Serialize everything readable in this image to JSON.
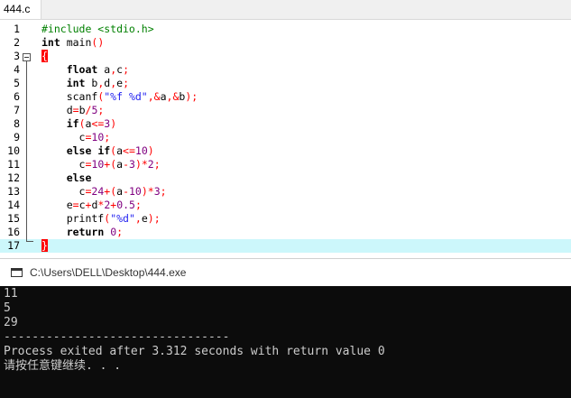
{
  "tab": {
    "label": "444.c"
  },
  "editor": {
    "line_numbers": [
      "1",
      "2",
      "3",
      "4",
      "5",
      "6",
      "7",
      "8",
      "9",
      "10",
      "11",
      "12",
      "13",
      "14",
      "15",
      "16",
      "17"
    ],
    "lines": [
      [
        {
          "t": "#include <stdio.h>",
          "c": "p"
        }
      ],
      [
        {
          "t": "int",
          "c": "k"
        },
        {
          "t": " main",
          "c": "x"
        },
        {
          "t": "()",
          "c": "o"
        }
      ],
      [
        {
          "t": "{",
          "c": "brace"
        }
      ],
      [],
      [
        {
          "t": "    ",
          "c": "x"
        },
        {
          "t": "float",
          "c": "k"
        },
        {
          "t": " a",
          "c": "x"
        },
        {
          "t": ",",
          "c": "o"
        },
        {
          "t": "c",
          "c": "x"
        },
        {
          "t": ";",
          "c": "o"
        }
      ],
      [
        {
          "t": "    ",
          "c": "x"
        },
        {
          "t": "int",
          "c": "k"
        },
        {
          "t": " b",
          "c": "x"
        },
        {
          "t": ",",
          "c": "o"
        },
        {
          "t": "d",
          "c": "x"
        },
        {
          "t": ",",
          "c": "o"
        },
        {
          "t": "e",
          "c": "x"
        },
        {
          "t": ";",
          "c": "o"
        }
      ],
      [
        {
          "t": "    scanf",
          "c": "x"
        },
        {
          "t": "(",
          "c": "o"
        },
        {
          "t": "\"%f %d\"",
          "c": "s"
        },
        {
          "t": ",&",
          "c": "o"
        },
        {
          "t": "a",
          "c": "x"
        },
        {
          "t": ",&",
          "c": "o"
        },
        {
          "t": "b",
          "c": "x"
        },
        {
          "t": ");",
          "c": "o"
        }
      ],
      [
        {
          "t": "    d",
          "c": "x"
        },
        {
          "t": "=",
          "c": "o"
        },
        {
          "t": "b",
          "c": "x"
        },
        {
          "t": "/",
          "c": "o"
        },
        {
          "t": "5",
          "c": "n"
        },
        {
          "t": ";",
          "c": "o"
        }
      ],
      [
        {
          "t": "    ",
          "c": "x"
        },
        {
          "t": "if",
          "c": "k"
        },
        {
          "t": "(",
          "c": "o"
        },
        {
          "t": "a",
          "c": "x"
        },
        {
          "t": "<=",
          "c": "o"
        },
        {
          "t": "3",
          "c": "n"
        },
        {
          "t": ")",
          "c": "o"
        }
      ],
      [
        {
          "t": "      c",
          "c": "x"
        },
        {
          "t": "=",
          "c": "o"
        },
        {
          "t": "10",
          "c": "n"
        },
        {
          "t": ";",
          "c": "o"
        }
      ],
      [
        {
          "t": "    ",
          "c": "x"
        },
        {
          "t": "else if",
          "c": "k"
        },
        {
          "t": "(",
          "c": "o"
        },
        {
          "t": "a",
          "c": "x"
        },
        {
          "t": "<=",
          "c": "o"
        },
        {
          "t": "10",
          "c": "n"
        },
        {
          "t": ")",
          "c": "o"
        }
      ],
      [
        {
          "t": "      c",
          "c": "x"
        },
        {
          "t": "=",
          "c": "o"
        },
        {
          "t": "10",
          "c": "n"
        },
        {
          "t": "+(",
          "c": "o"
        },
        {
          "t": "a",
          "c": "x"
        },
        {
          "t": "-",
          "c": "o"
        },
        {
          "t": "3",
          "c": "n"
        },
        {
          "t": ")*",
          "c": "o"
        },
        {
          "t": "2",
          "c": "n"
        },
        {
          "t": ";",
          "c": "o"
        }
      ],
      [
        {
          "t": "    ",
          "c": "x"
        },
        {
          "t": "else",
          "c": "k"
        }
      ],
      [
        {
          "t": "      c",
          "c": "x"
        },
        {
          "t": "=",
          "c": "o"
        },
        {
          "t": "24",
          "c": "n"
        },
        {
          "t": "+(",
          "c": "o"
        },
        {
          "t": "a",
          "c": "x"
        },
        {
          "t": "-",
          "c": "o"
        },
        {
          "t": "10",
          "c": "n"
        },
        {
          "t": ")*",
          "c": "o"
        },
        {
          "t": "3",
          "c": "n"
        },
        {
          "t": ";",
          "c": "o"
        }
      ],
      [
        {
          "t": "    e",
          "c": "x"
        },
        {
          "t": "=",
          "c": "o"
        },
        {
          "t": "c",
          "c": "x"
        },
        {
          "t": "+",
          "c": "o"
        },
        {
          "t": "d",
          "c": "x"
        },
        {
          "t": "*",
          "c": "o"
        },
        {
          "t": "2",
          "c": "n"
        },
        {
          "t": "+",
          "c": "o"
        },
        {
          "t": "0.5",
          "c": "n"
        },
        {
          "t": ";",
          "c": "o"
        }
      ],
      [
        {
          "t": "    printf",
          "c": "x"
        },
        {
          "t": "(",
          "c": "o"
        },
        {
          "t": "\"%d\"",
          "c": "s"
        },
        {
          "t": ",",
          "c": "o"
        },
        {
          "t": "e",
          "c": "x"
        },
        {
          "t": ");",
          "c": "o"
        }
      ],
      [
        {
          "t": "    ",
          "c": "x"
        },
        {
          "t": "return",
          "c": "k"
        },
        {
          "t": " ",
          "c": "x"
        },
        {
          "t": "0",
          "c": "n"
        },
        {
          "t": ";",
          "c": "o"
        }
      ],
      [
        {
          "t": "}",
          "c": "brace"
        }
      ]
    ]
  },
  "console": {
    "title": "C:\\Users\\DELL\\Desktop\\444.exe",
    "output": [
      "11",
      "5",
      "29",
      "--------------------------------",
      "Process exited after 3.312 seconds with return value 0",
      "请按任意键继续. . ."
    ]
  }
}
